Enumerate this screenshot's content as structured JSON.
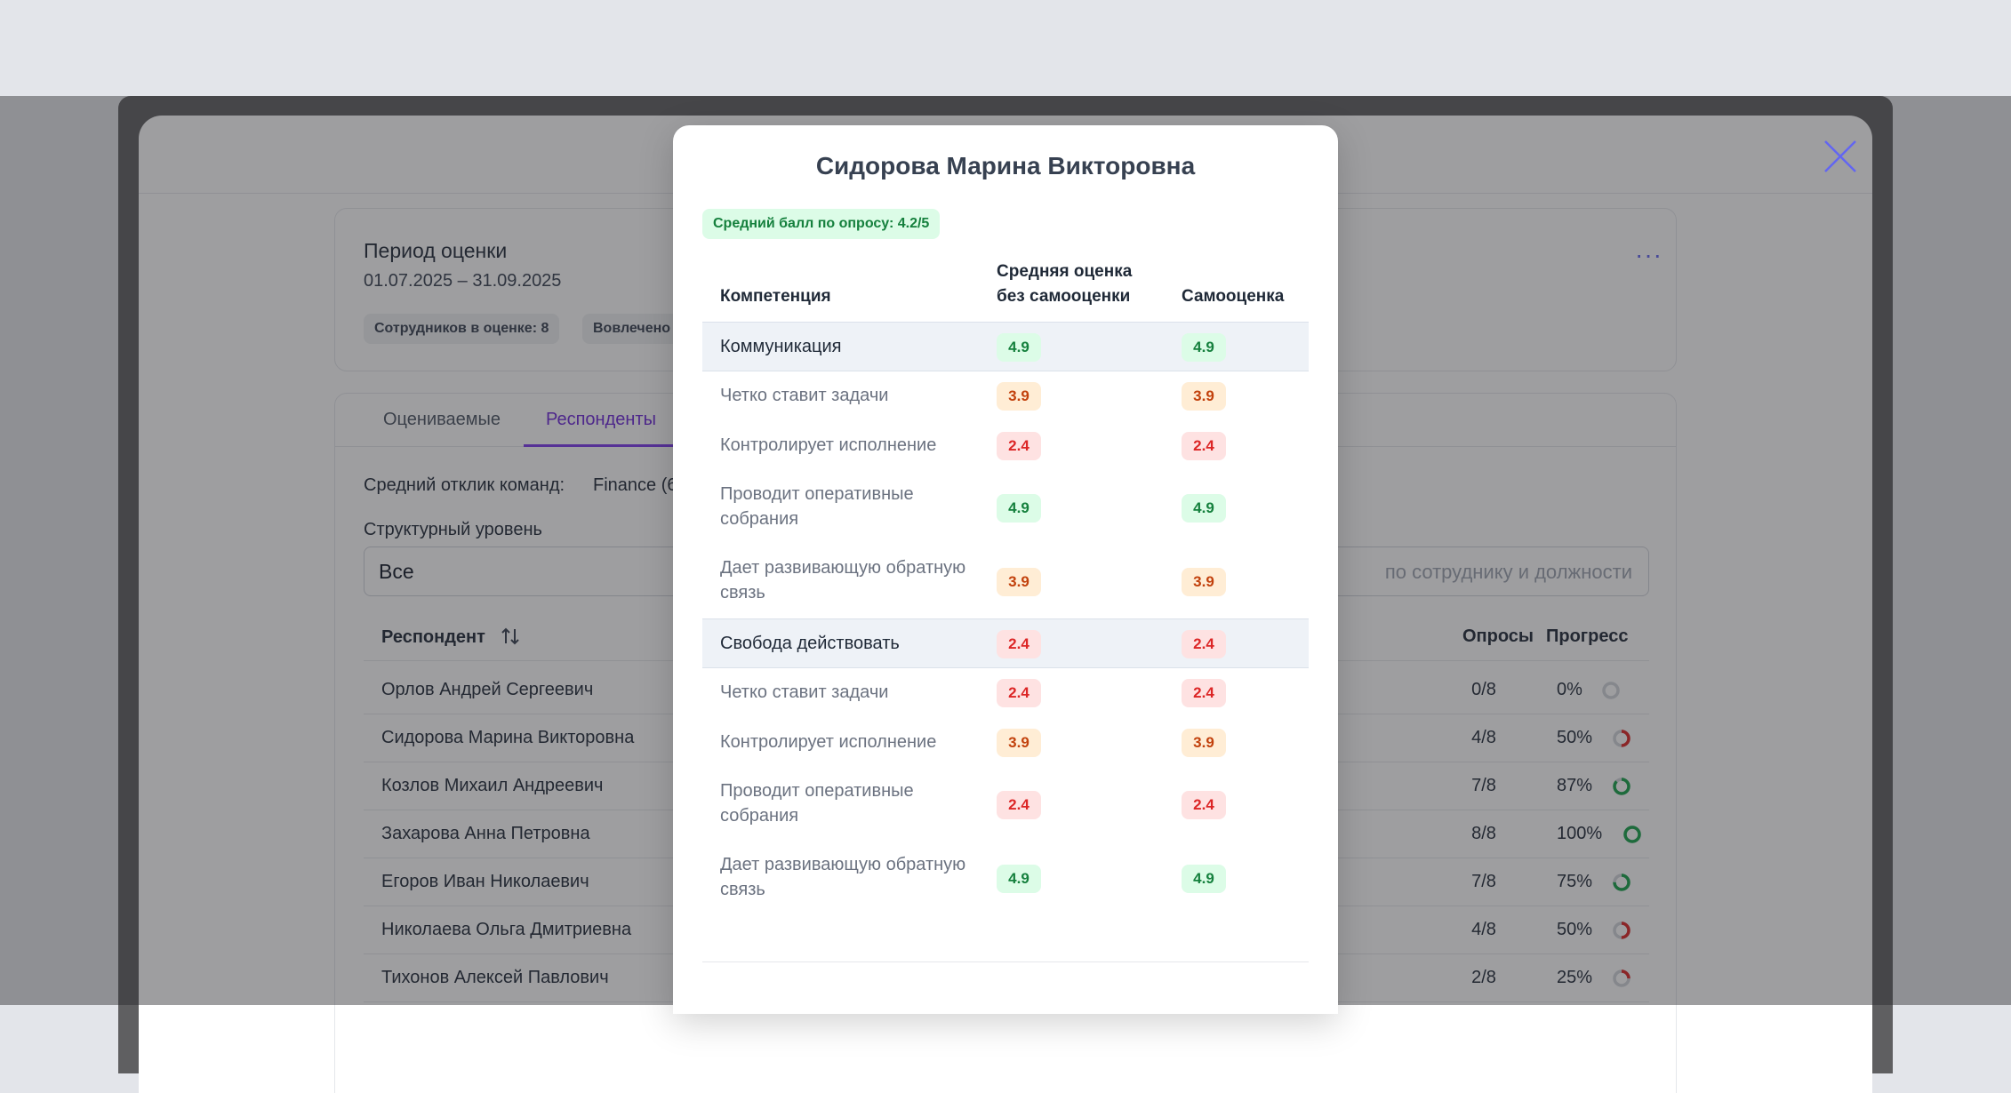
{
  "period": {
    "title": "Период оценки",
    "range": "01.07.2025 – 31.09.2025",
    "chip_employees": "Сотрудников в оценке: 8",
    "chip_involved": "Вовлечено",
    "more": "···"
  },
  "tabs": [
    {
      "label": "Оцениваемые",
      "active": false
    },
    {
      "label": "Респонденты",
      "active": true
    }
  ],
  "filters": {
    "avg_label": "Средний отклик команд:",
    "avg_team": "Finance (6",
    "struct_label": "Структурный уровень",
    "struct_value": "Все",
    "search_placeholder": "по сотруднику и должности"
  },
  "table": {
    "col_respondent": "Респондент",
    "col_surveys": "Опросы",
    "col_progress": "Прогресс",
    "rows": [
      {
        "name": "Орлов Андрей Сергеевич",
        "surveys": "0/8",
        "pct": "0%",
        "progress": 0
      },
      {
        "name": "Сидорова Марина Викторовна",
        "surveys": "4/8",
        "pct": "50%",
        "progress": 50
      },
      {
        "name": "Козлов Михаил Андреевич",
        "surveys": "7/8",
        "pct": "87%",
        "progress": 87
      },
      {
        "name": "Захарова Анна Петровна",
        "surveys": "8/8",
        "pct": "100%",
        "progress": 100
      },
      {
        "name": "Егоров Иван Николаевич",
        "surveys": "7/8",
        "pct": "75%",
        "progress": 75
      },
      {
        "name": "Николаева Ольга Дмитриевна",
        "surveys": "4/8",
        "pct": "50%",
        "progress": 50
      },
      {
        "name": "Тихонов Алексей Павлович",
        "surveys": "2/8",
        "pct": "25%",
        "progress": 25
      }
    ]
  },
  "modal": {
    "title": "Сидорова Марина Викторовна",
    "badge": "Средний балл по опросу: 4.2/5",
    "col_competency": "Компетенция",
    "col_avg_line1": "Средняя оценка",
    "col_avg_line2": "без самооценки",
    "col_self": "Самооценка",
    "rows": [
      {
        "label": "Коммуникация",
        "group": true,
        "avg": "4.9",
        "self": "4.9",
        "avg_level": "green",
        "self_level": "green"
      },
      {
        "label": "Четко ставит задачи",
        "group": false,
        "avg": "3.9",
        "self": "3.9",
        "avg_level": "orange",
        "self_level": "orange"
      },
      {
        "label": "Контролирует исполнение",
        "group": false,
        "avg": "2.4",
        "self": "2.4",
        "avg_level": "red",
        "self_level": "red"
      },
      {
        "label": "Проводит оперативные собрания",
        "group": false,
        "avg": "4.9",
        "self": "4.9",
        "avg_level": "green",
        "self_level": "green"
      },
      {
        "label": "Дает развивающую обратную связь",
        "group": false,
        "avg": "3.9",
        "self": "3.9",
        "avg_level": "orange",
        "self_level": "orange"
      },
      {
        "label": "Свобода действовать",
        "group": true,
        "avg": "2.4",
        "self": "2.4",
        "avg_level": "red",
        "self_level": "red"
      },
      {
        "label": "Четко ставит задачи",
        "group": false,
        "avg": "2.4",
        "self": "2.4",
        "avg_level": "red",
        "self_level": "red"
      },
      {
        "label": "Контролирует исполнение",
        "group": false,
        "avg": "3.9",
        "self": "3.9",
        "avg_level": "orange",
        "self_level": "orange"
      },
      {
        "label": "Проводит оперативные собрания",
        "group": false,
        "avg": "2.4",
        "self": "2.4",
        "avg_level": "red",
        "self_level": "red"
      },
      {
        "label": "Дает развивающую обратную связь",
        "group": false,
        "avg": "4.9",
        "self": "4.9",
        "avg_level": "green",
        "self_level": "green"
      }
    ]
  },
  "colors": {
    "accent": "#6d28d9",
    "close_icon": "#6366f1",
    "good": "#15803d",
    "mid": "#c2410c",
    "bad": "#dc2626"
  }
}
